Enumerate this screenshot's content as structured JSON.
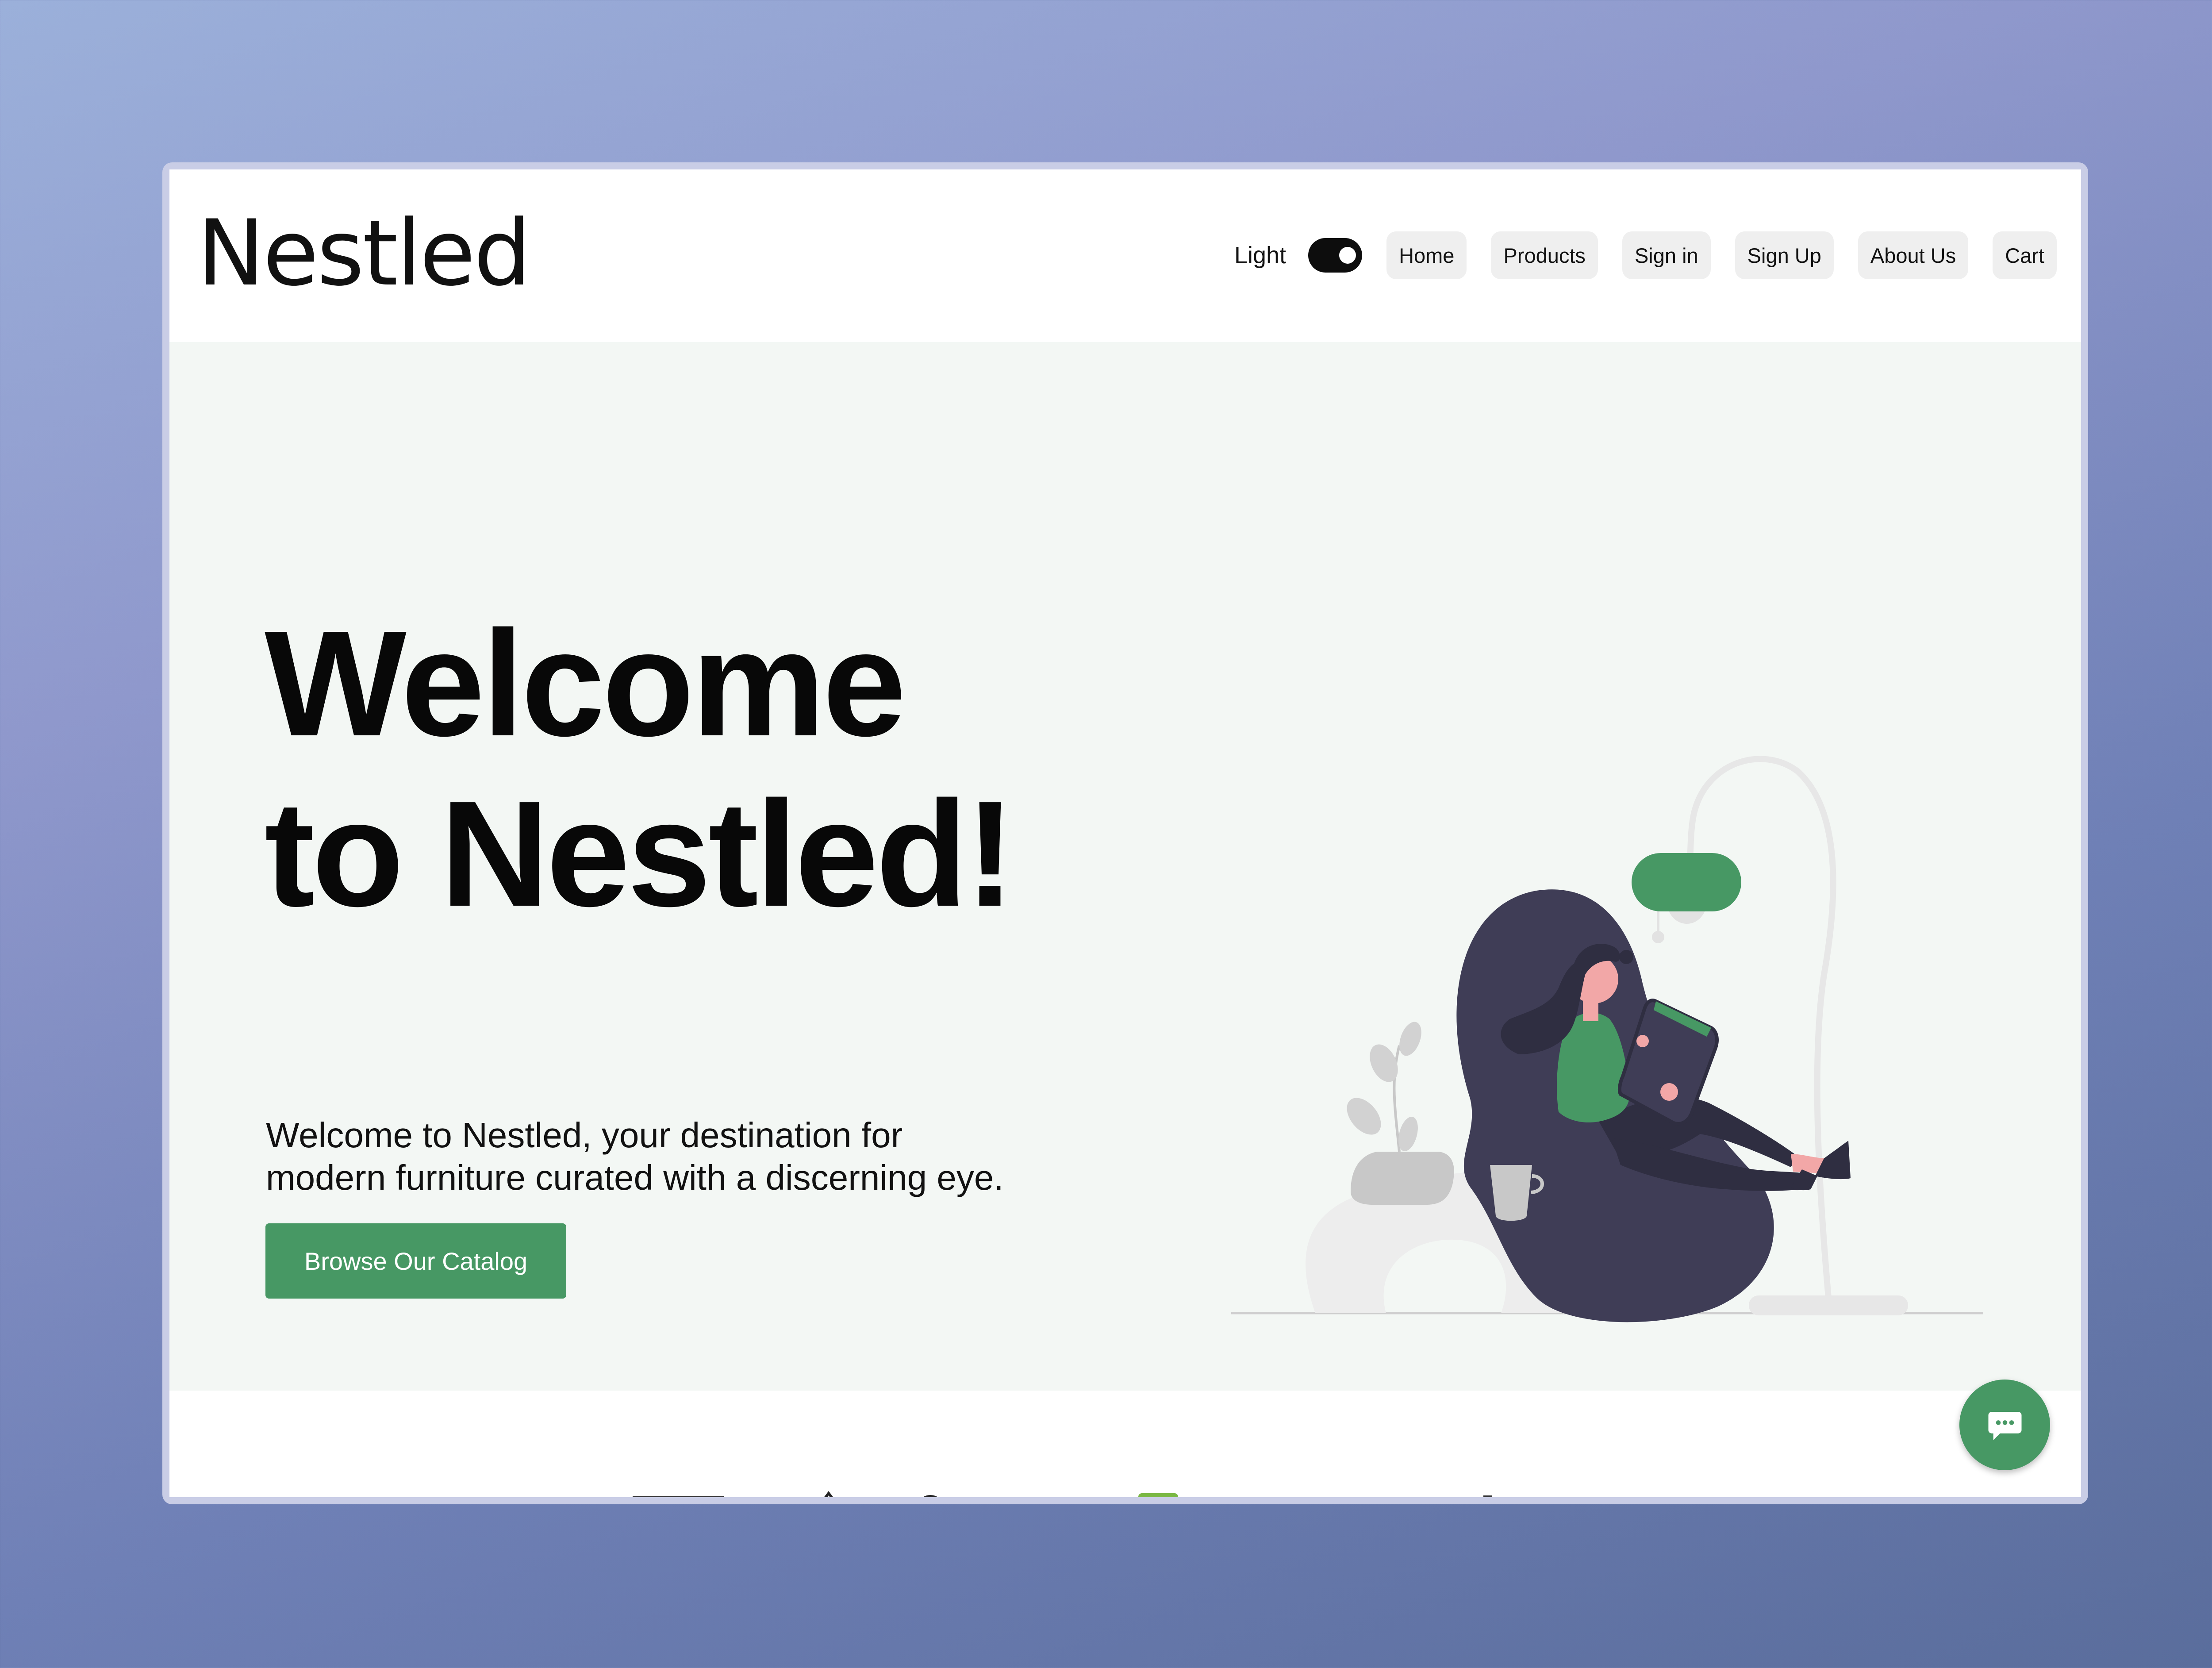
{
  "header": {
    "logo": "Nestled",
    "theme_label": "Light",
    "nav": [
      "Home",
      "Products",
      "Sign in",
      "Sign Up",
      "About Us",
      "Cart"
    ]
  },
  "hero": {
    "title_line1": "Welcome",
    "title_line2": "to Nestled!",
    "subtitle_line1": "Welcome to Nestled, your destination for",
    "subtitle_line2": "modern furniture curated with a discerning eye.",
    "cta_label": "Browse Our Catalog"
  },
  "colors": {
    "accent_green": "#479864",
    "hero_background": "#f3f7f4",
    "text": "#080808"
  },
  "icons": {
    "toggle": "theme-toggle-icon",
    "chat": "chat-bubble-icon"
  }
}
